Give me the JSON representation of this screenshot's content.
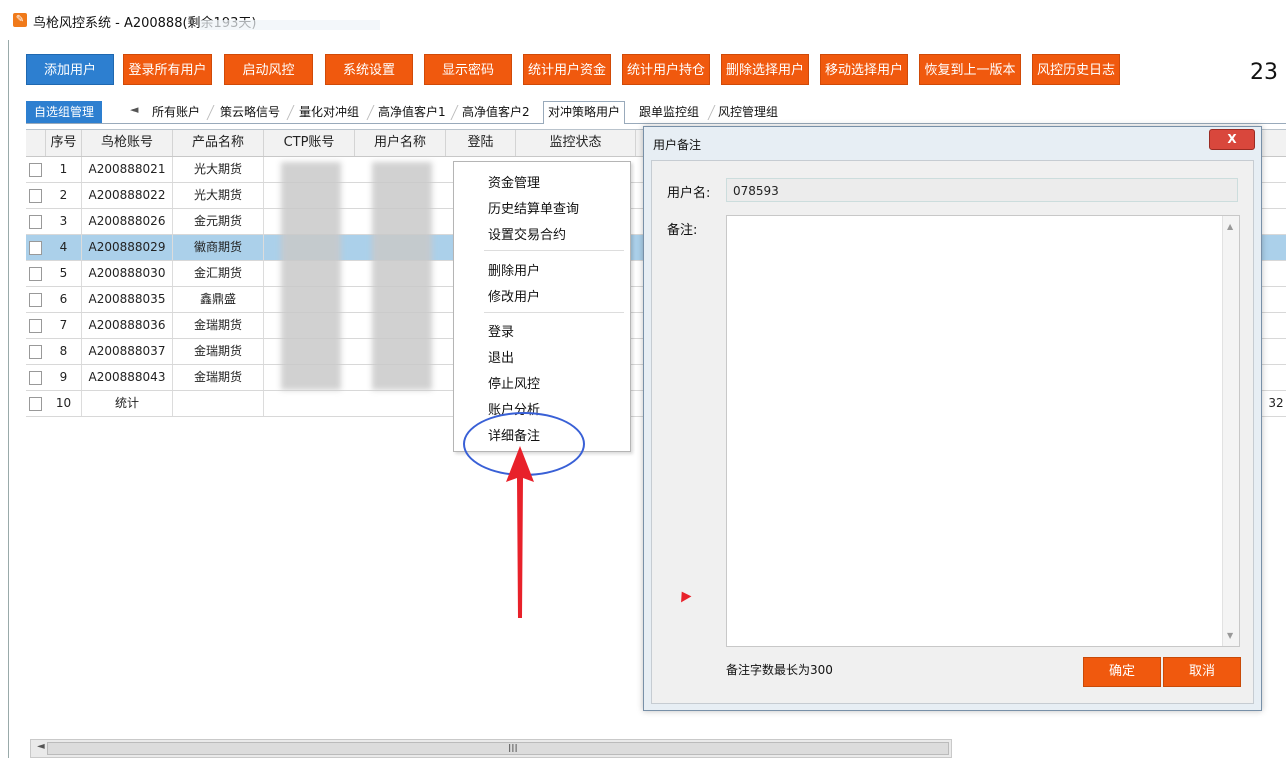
{
  "window": {
    "title": "鸟枪风控系统 - A200888(剩余193天)",
    "clock": "23"
  },
  "toolbar": [
    "添加用户",
    "登录所有用户",
    "启动风控",
    "系统设置",
    "显示密码",
    "统计用户资金",
    "统计用户持仓",
    "删除选择用户",
    "移动选择用户",
    "恢复到上一版本",
    "风控历史日志"
  ],
  "tabs": {
    "group_tab": "自选组管理",
    "prev_arrow": "◄",
    "items": [
      "所有账户",
      "策云略信号",
      "量化对冲组",
      "高净值客户1",
      "高净值客户2",
      "对冲策略用户",
      "跟单监控组",
      "风控管理组"
    ],
    "active": "对冲策略用户"
  },
  "table": {
    "headers": [
      "序号",
      "鸟枪账号",
      "产品名称",
      "CTP账号",
      "用户名称",
      "登陆",
      "监控状态"
    ],
    "rows": [
      [
        "1",
        "A200888021",
        "光大期货"
      ],
      [
        "2",
        "A200888022",
        "光大期货"
      ],
      [
        "3",
        "A200888026",
        "金元期货"
      ],
      [
        "4",
        "A200888029",
        "徽商期货"
      ],
      [
        "5",
        "A200888030",
        "金汇期货"
      ],
      [
        "6",
        "A200888035",
        "鑫鼎盛"
      ],
      [
        "7",
        "A200888036",
        "金瑞期货"
      ],
      [
        "8",
        "A200888037",
        "金瑞期货"
      ],
      [
        "9",
        "A200888043",
        "金瑞期货"
      ],
      [
        "10",
        "统计",
        ""
      ]
    ],
    "selected_row": 3,
    "edge_value": "32"
  },
  "context_menu": [
    "资金管理",
    "历史结算单查询",
    "设置交易合约",
    "删除用户",
    "修改用户",
    "登录",
    "退出",
    "停止风控",
    "账户分析",
    "详细备注"
  ],
  "dialog": {
    "title": "用户备注",
    "close": "X",
    "username_label": "用户名:",
    "username_value": "078593",
    "note_label": "备注:",
    "hint": "备注字数最长为300",
    "ok": "确定",
    "cancel": "取消"
  },
  "scrollbar": {
    "grip": "III"
  },
  "colors": {
    "accent_orange": "#f0590e",
    "accent_blue": "#2d7fd0",
    "selection": "#abd0ea",
    "annotation_red": "#e8212a",
    "annotation_blue": "#3960d6"
  }
}
